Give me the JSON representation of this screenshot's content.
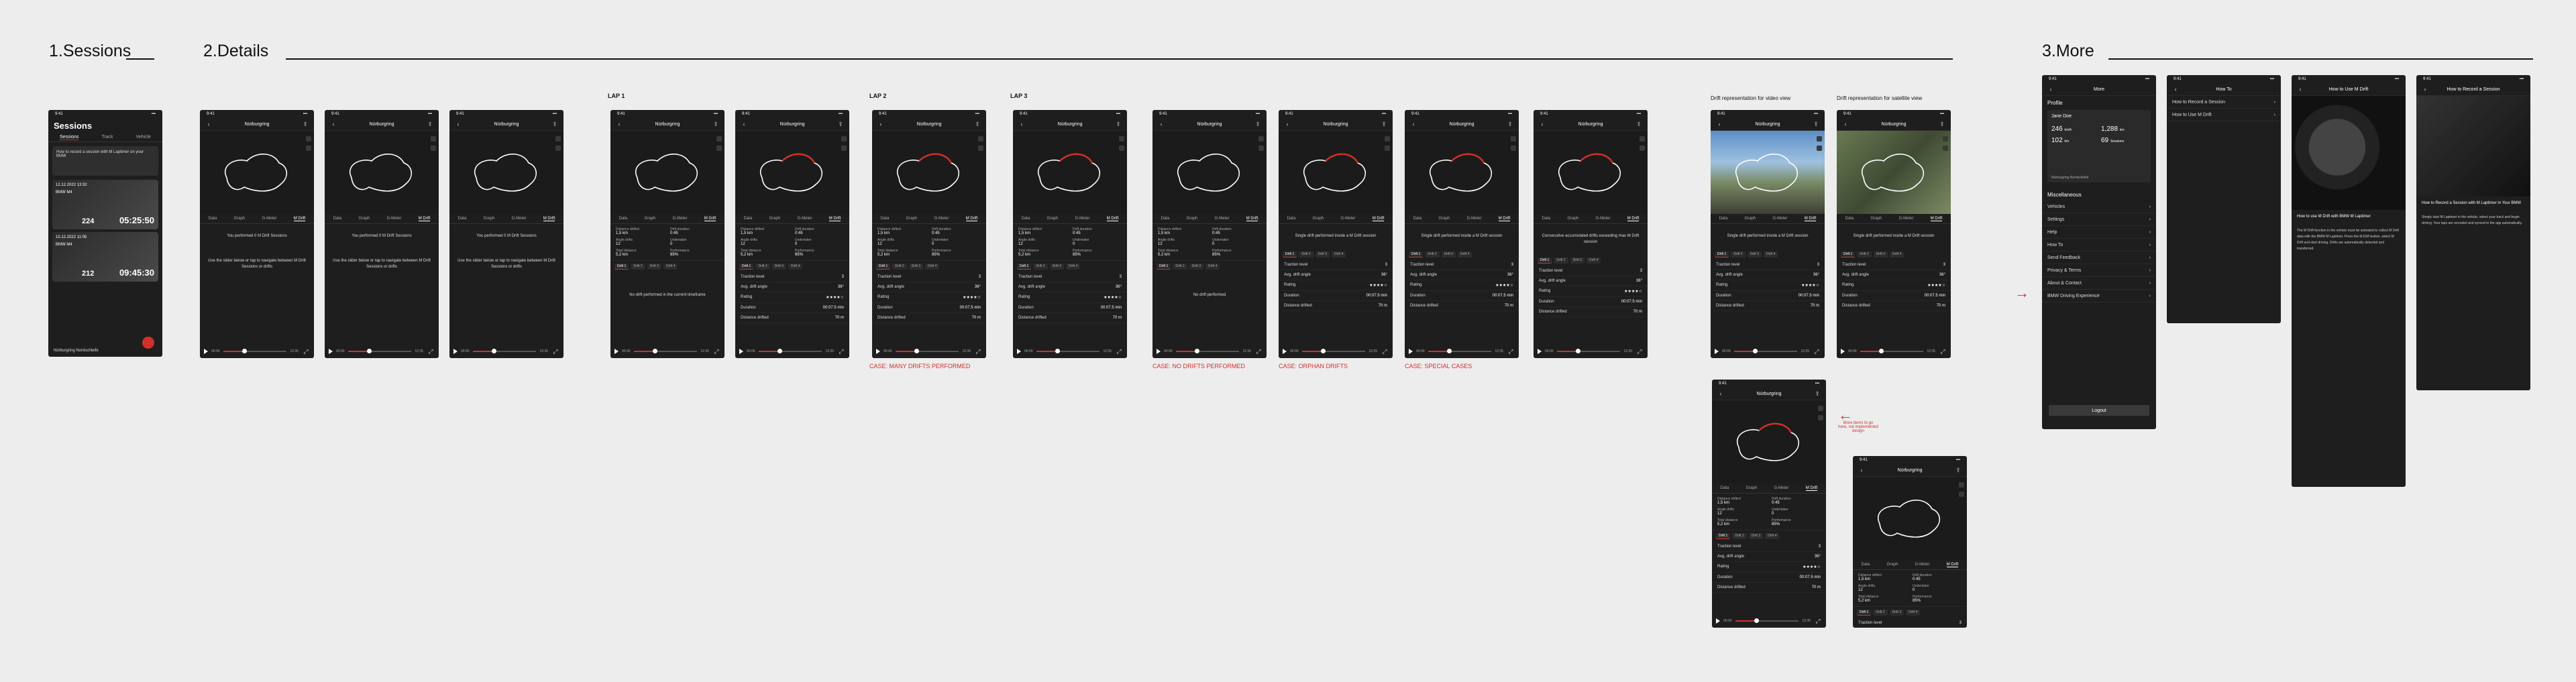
{
  "sections": {
    "sessions": "1.Sessions",
    "details": "2.Details",
    "more": "3.More"
  },
  "lap_labels": [
    "LAP 1",
    "LAP 2",
    "LAP 3"
  ],
  "drift_labels": {
    "video": "Drift representation for video view",
    "satellite": "Drift representation for satellite view"
  },
  "cases": {
    "many": "CASE: MANY DRIFTS PERFORMED",
    "none": "CASE: NO DRIFTS PERFORMED",
    "orphan": "CASE: ORPHAN DRIFTS",
    "special": "CASE: SPECIAL CASES"
  },
  "annotation_note": "More items to go here, not implemented design",
  "status_time": "9:41",
  "track": "Nürburgring",
  "tabs": [
    "Data",
    "Graph",
    "G-Meter",
    "M Drift"
  ],
  "sessions_screen": {
    "title": "Sessions",
    "segments": [
      "Sessions",
      "Track",
      "Vehicle"
    ],
    "hint": "How to record a session with M Laptimer on your BMW",
    "cards": [
      {
        "date": "12.12.2022 13:32",
        "track": "Nürburgring Nordschleife",
        "car": "BMW M4",
        "km": "224",
        "time": "05:25:50"
      },
      {
        "date": "10.12.2022 11:05",
        "track": "Nürburgring Nordschleife",
        "car": "BMW M4",
        "km": "212",
        "time": "09:45:30"
      }
    ],
    "footer": "Nürburgring Nordschleife"
  },
  "messages": {
    "performed": "You performed 0 M Drift Sessions",
    "select": "Use the slider below or tap to navigate between M Drift Sessions or drifts",
    "no_drift_current": "No drift performed in the current timeframe",
    "no_drift": "No drift performed",
    "single": "Single drift performed inside a M Drift session",
    "special": "Consecutive accumulated drifts exceeding max M Drift session"
  },
  "detail_fields": {
    "session": "Session 1",
    "labels": [
      "Distance drifted",
      "Drift duration",
      "Angle drifts",
      "Undertaker",
      "Total distance",
      "Performance"
    ],
    "values": [
      "1,5 km",
      "0:45",
      "12",
      "0",
      "5,2 km",
      "85%"
    ]
  },
  "laps_row": [
    "Drift 1",
    "Drift 2",
    "Drift 3",
    "Drift 4"
  ],
  "stats": [
    {
      "label": "Traction level",
      "value": "3"
    },
    {
      "label": "Avg. drift angle",
      "value": "36°"
    },
    {
      "label": "Rating",
      "value": "★★★★☆"
    },
    {
      "label": "Duration",
      "value": "00:07.5 min"
    },
    {
      "label": "Distance drifted",
      "value": "70 m"
    }
  ],
  "player": {
    "start": "00:00",
    "end": "12:35"
  },
  "more": {
    "title": "More",
    "profile": "Profile",
    "user": "Jane Doe",
    "stats": [
      {
        "value": "246",
        "unit": "km/h",
        "label": "Top speed"
      },
      {
        "value": "1,288",
        "unit": "km",
        "label": "Distance"
      },
      {
        "value": "102",
        "unit": "km",
        "label": "Drifted"
      },
      {
        "value": "69",
        "unit": "",
        "label": "Sessions"
      }
    ],
    "favourite": "Nürburgring Nordschleife",
    "misc_title": "Miscellaneous",
    "items": [
      "Vehicles",
      "Settings",
      "Help",
      "How To",
      "Send Feedback",
      "Privacy & Terms",
      "About & Contact",
      "BMW Driving Experience"
    ],
    "logout": "Logout"
  },
  "howto": {
    "title": "How To",
    "items": [
      "How to Record a Session",
      "How to Use M Drift"
    ]
  },
  "help_drift": {
    "title": "How to Use M Drift",
    "heading": "How to use M Drift with BMW M Laptimer",
    "body": "The M Drift function in the vehicle must be activated to collect M Drift data with the BMW M Laptimer. Press the M Drift button, select M Drift and start driving. Drifts are automatically detected and transferred."
  },
  "help_session": {
    "title": "How to Record a Session",
    "heading": "How to Record a Session with M Laptimer in Your BMW",
    "body": "Simply start M Laptimer in the vehicle, select your track and begin driving. Your laps are recorded and synced to the app automatically."
  },
  "colors": {
    "accent": "#d0302b",
    "screen": "#1e1e1e",
    "canvas": "#ededed"
  }
}
